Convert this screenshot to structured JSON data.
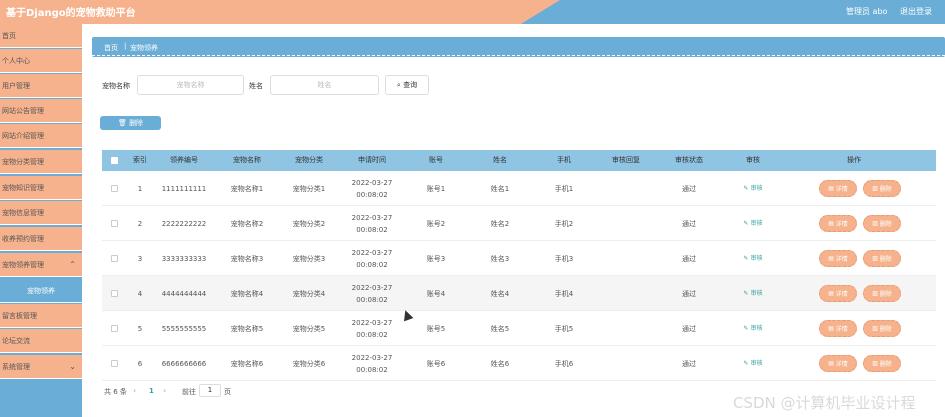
{
  "header": {
    "title": "基于Django的宠物救助平台",
    "admin_label": "管理员 abo",
    "logout_label": "退出登录"
  },
  "sidebar": {
    "items": [
      {
        "label": "首页"
      },
      {
        "label": "个人中心"
      },
      {
        "label": "用户管理"
      },
      {
        "label": "网站公告管理"
      },
      {
        "label": "网站介绍管理"
      },
      {
        "label": "宠物分类管理"
      },
      {
        "label": "宠物知识管理"
      },
      {
        "label": "宠物信息管理"
      },
      {
        "label": "收养预约管理"
      },
      {
        "label": "宠物领养管理"
      },
      {
        "label": "宠物领养"
      },
      {
        "label": "留言板管理"
      },
      {
        "label": "论坛交流"
      },
      {
        "label": "系统管理"
      }
    ]
  },
  "breadcrumb": {
    "home": "首页",
    "separator": "|",
    "current": "宠物领养"
  },
  "search": {
    "pet_name_label": "宠物名称",
    "pet_name_placeholder": "宠物名称",
    "name_label": "姓名",
    "name_placeholder": "姓名",
    "search_button": "查询"
  },
  "toolbar": {
    "delete_label": "删除"
  },
  "table": {
    "headers": [
      "索引",
      "领养编号",
      "宠物名称",
      "宠物分类",
      "申请时间",
      "账号",
      "姓名",
      "手机",
      "审核回复",
      "审核状态",
      "审核",
      "操作"
    ],
    "audit_link": "审核",
    "detail_label": "详情",
    "delete_label": "删除",
    "rows": [
      {
        "index": "1",
        "code": "1111111111",
        "pet_name": "宠物名称1",
        "category": "宠物分类1",
        "time": "2022-03-27 00:08:02",
        "account": "账号1",
        "name": "姓名1",
        "phone": "手机1",
        "reply": "",
        "status": "通过"
      },
      {
        "index": "2",
        "code": "2222222222",
        "pet_name": "宠物名称2",
        "category": "宠物分类2",
        "time": "2022-03-27 00:08:02",
        "account": "账号2",
        "name": "姓名2",
        "phone": "手机2",
        "reply": "",
        "status": "通过"
      },
      {
        "index": "3",
        "code": "3333333333",
        "pet_name": "宠物名称3",
        "category": "宠物分类3",
        "time": "2022-03-27 00:08:02",
        "account": "账号3",
        "name": "姓名3",
        "phone": "手机3",
        "reply": "",
        "status": "通过"
      },
      {
        "index": "4",
        "code": "4444444444",
        "pet_name": "宠物名称4",
        "category": "宠物分类4",
        "time": "2022-03-27 00:08:02",
        "account": "账号4",
        "name": "姓名4",
        "phone": "手机4",
        "reply": "",
        "status": "通过"
      },
      {
        "index": "5",
        "code": "5555555555",
        "pet_name": "宠物名称5",
        "category": "宠物分类5",
        "time": "2022-03-27 00:08:02",
        "account": "账号5",
        "name": "姓名5",
        "phone": "手机5",
        "reply": "",
        "status": "通过"
      },
      {
        "index": "6",
        "code": "6666666666",
        "pet_name": "宠物名称6",
        "category": "宠物分类6",
        "time": "2022-03-27 00:08:02",
        "account": "账号6",
        "name": "姓名6",
        "phone": "手机6",
        "reply": "",
        "status": "通过"
      }
    ]
  },
  "pagination": {
    "total": "共 6 条",
    "prev": "‹",
    "current_page": "1",
    "next": "›",
    "goto_label": "前往",
    "goto_value": "1",
    "unit": "页"
  },
  "watermark": "CSDN @计算机毕业设计程",
  "colors": {
    "accent_blue": "#6aadd6",
    "accent_peach": "#f6b28d",
    "link_teal": "#3aa0a0"
  }
}
